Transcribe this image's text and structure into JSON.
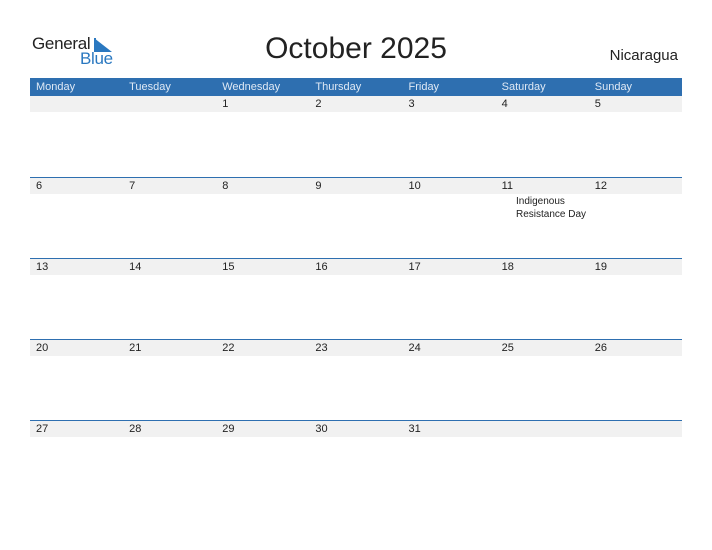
{
  "logo": {
    "word1": "General",
    "word2": "Blue"
  },
  "title": "October 2025",
  "country": "Nicaragua",
  "colors": {
    "header_bg": "#2e6fb0",
    "date_row_bg": "#f1f1f1",
    "brand_blue": "#2a78c0"
  },
  "weekdays": [
    "Monday",
    "Tuesday",
    "Wednesday",
    "Thursday",
    "Friday",
    "Saturday",
    "Sunday"
  ],
  "weeks": [
    {
      "days": [
        "",
        "",
        "1",
        "2",
        "3",
        "4",
        "5"
      ],
      "events": [
        "",
        "",
        "",
        "",
        "",
        "",
        ""
      ]
    },
    {
      "days": [
        "6",
        "7",
        "8",
        "9",
        "10",
        "11",
        "12"
      ],
      "events": [
        "",
        "",
        "",
        "",
        "",
        "",
        "Indigenous Resistance Day"
      ]
    },
    {
      "days": [
        "13",
        "14",
        "15",
        "16",
        "17",
        "18",
        "19"
      ],
      "events": [
        "",
        "",
        "",
        "",
        "",
        "",
        ""
      ]
    },
    {
      "days": [
        "20",
        "21",
        "22",
        "23",
        "24",
        "25",
        "26"
      ],
      "events": [
        "",
        "",
        "",
        "",
        "",
        "",
        ""
      ]
    },
    {
      "days": [
        "27",
        "28",
        "29",
        "30",
        "31",
        "",
        ""
      ],
      "events": [
        "",
        "",
        "",
        "",
        "",
        "",
        ""
      ]
    }
  ]
}
